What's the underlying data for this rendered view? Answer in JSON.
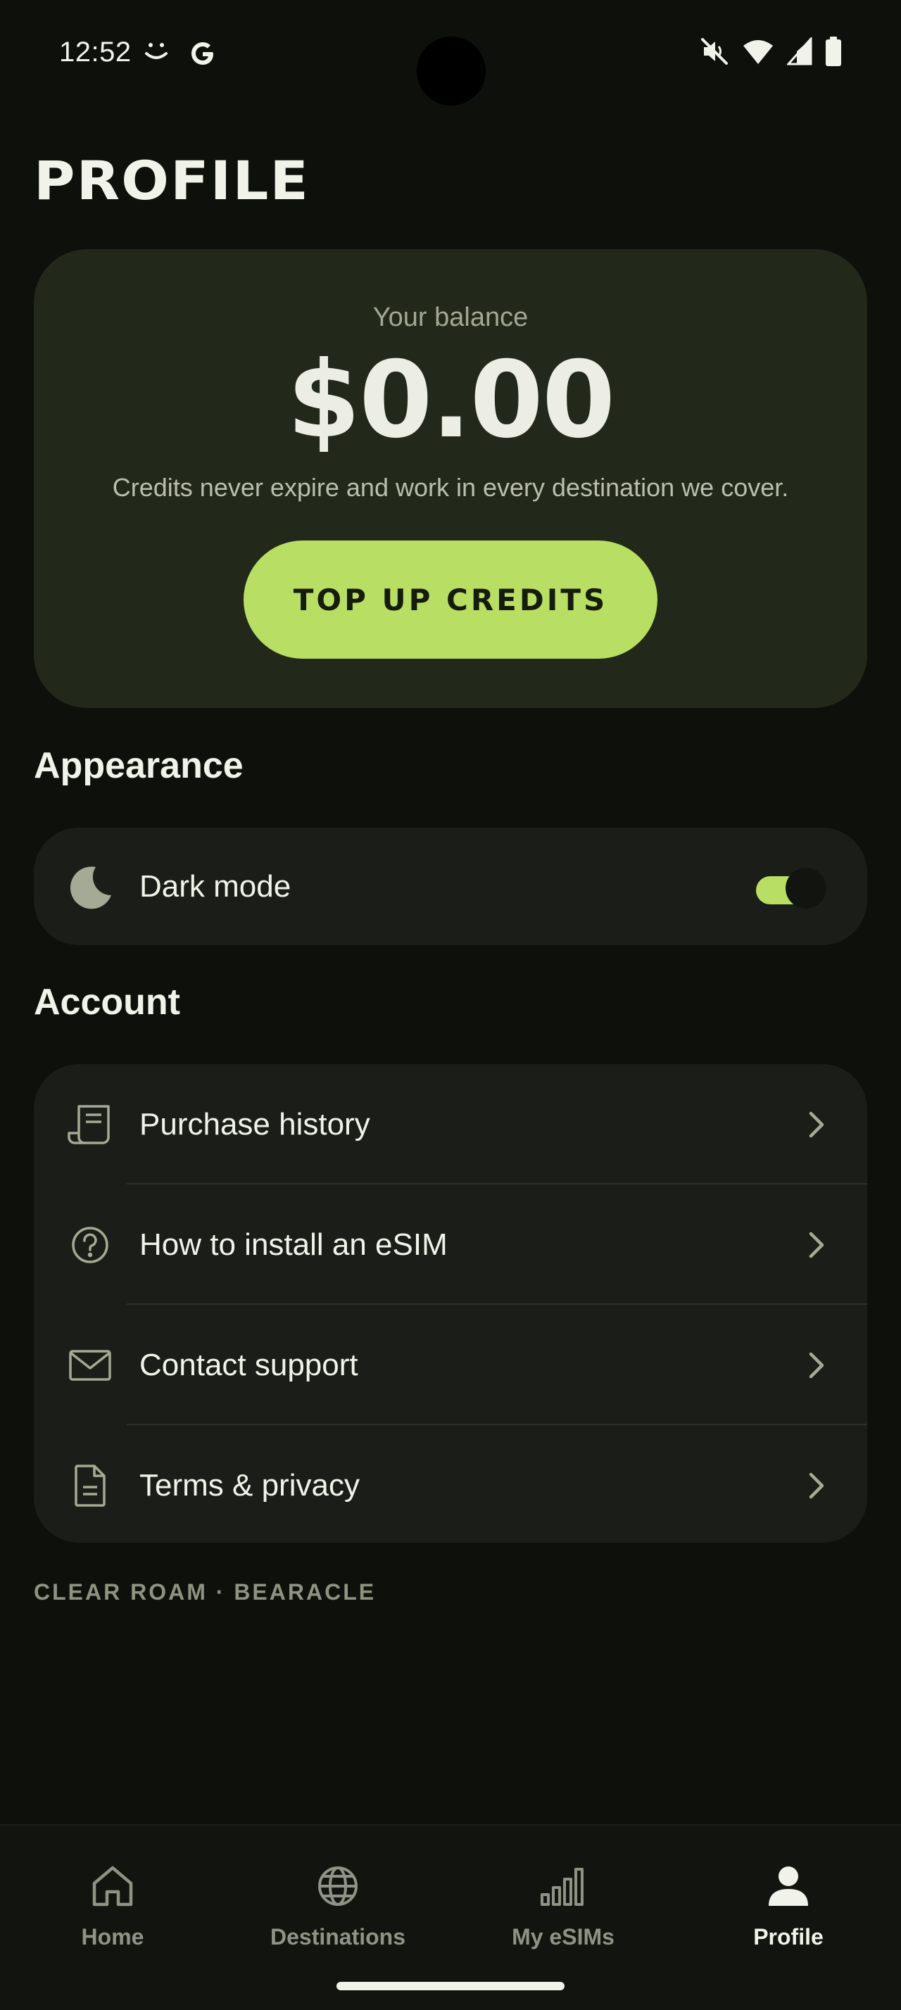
{
  "status_bar": {
    "time": "12:52"
  },
  "page": {
    "title": "PROFILE"
  },
  "balance": {
    "label": "Your balance",
    "amount": "$0.00",
    "note": "Credits never expire and work in every destination we cover.",
    "topup_label": "TOP UP CREDITS"
  },
  "appearance": {
    "heading": "Appearance",
    "dark_mode_label": "Dark mode",
    "dark_mode_enabled": true
  },
  "account": {
    "heading": "Account",
    "items": [
      {
        "label": "Purchase history",
        "icon": "receipt-icon"
      },
      {
        "label": "How to install an eSIM",
        "icon": "help-circle-icon"
      },
      {
        "label": "Contact support",
        "icon": "mail-icon"
      },
      {
        "label": "Terms & privacy",
        "icon": "document-icon"
      }
    ]
  },
  "footer": {
    "brand": "CLEAR ROAM · BEARACLE"
  },
  "nav": {
    "items": [
      {
        "label": "Home",
        "icon": "home-icon",
        "active": false
      },
      {
        "label": "Destinations",
        "icon": "globe-icon",
        "active": false
      },
      {
        "label": "My eSIMs",
        "icon": "signal-bars-icon",
        "active": false
      },
      {
        "label": "Profile",
        "icon": "person-icon",
        "active": true
      }
    ]
  },
  "colors": {
    "background": "#0d100b",
    "card": "#22291b",
    "accent": "#b8df63",
    "row_card": "#1b1e18"
  }
}
